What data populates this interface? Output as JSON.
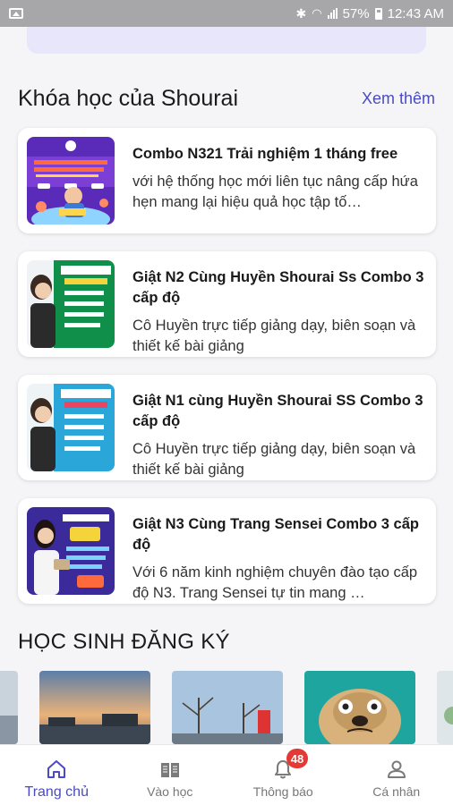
{
  "status_bar": {
    "battery": "57%",
    "time": "12:43 AM"
  },
  "courses_section": {
    "title": "Khóa học của Shourai",
    "see_more": "Xem thêm"
  },
  "courses": [
    {
      "title": "Combo N321 Trải nghiệm 1 tháng free",
      "description": "với hệ thống học mới liên tục nâng cấp hứa hẹn mang lại hiệu quả học tập tố…"
    },
    {
      "title": "Giật N2 Cùng Huyền Shourai Ss Combo 3 cấp độ",
      "description": "Cô Huyền trực tiếp giảng dạy, biên soạn và thiết kế bài giảng"
    },
    {
      "title": "Giật N1 cùng Huyền Shourai SS Combo 3 cấp độ",
      "description": "Cô Huyền trực tiếp giảng dạy, biên soạn và thiết kế bài giảng"
    },
    {
      "title": "Giật N3 Cùng Trang Sensei Combo 3 cấp độ",
      "description": "Với 6 năm kinh nghiệm chuyên đào tạo cấp độ N3. Trang Sensei tự tin mang …"
    }
  ],
  "students_section": {
    "title": "HỌC SINH ĐĂNG KÝ"
  },
  "tabbar": {
    "home": "Trang chủ",
    "study": "Vào học",
    "notifications": "Thông báo",
    "notifications_badge": "48",
    "profile": "Cá nhân"
  },
  "colors": {
    "accent": "#4a4ac4",
    "badge": "#e53935",
    "status_bar": "#a7a7a9"
  }
}
